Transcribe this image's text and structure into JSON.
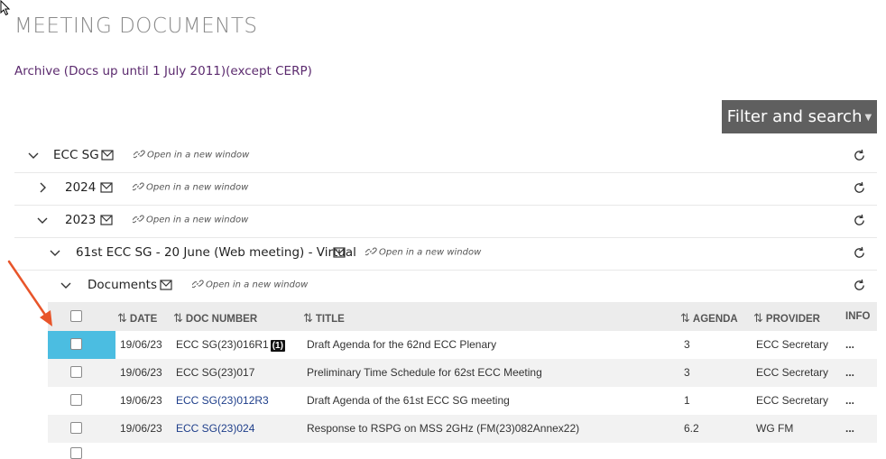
{
  "page": {
    "title": "MEETING DOCUMENTS",
    "archive_link": "Archive (Docs up until 1 July 2011)(except CERP)",
    "filter_button": "Filter and search"
  },
  "tree": {
    "open_new_window": "Open in a new window",
    "rows": [
      {
        "label": "ECC SG",
        "expanded": true
      },
      {
        "label": "2024",
        "expanded": false
      },
      {
        "label": "2023",
        "expanded": true
      },
      {
        "label": "61st ECC SG - 20 June (Web meeting) - Virtual",
        "expanded": true
      },
      {
        "label": "Documents",
        "expanded": true
      }
    ]
  },
  "table": {
    "headers": {
      "date": "DATE",
      "doc_number": "DOC NUMBER",
      "title": "TITLE",
      "agenda": "AGENDA",
      "provider": "PROVIDER",
      "info": "INFO"
    },
    "rows": [
      {
        "date": "19/06/23",
        "doc_number": "ECC SG(23)016R1",
        "badge": "(1)",
        "title": "Draft Agenda for the 62nd ECC Plenary",
        "agenda": "3",
        "provider": "ECC Secretary",
        "info": "...",
        "link": false
      },
      {
        "date": "19/06/23",
        "doc_number": "ECC SG(23)017",
        "badge": "",
        "title": "Preliminary Time Schedule for 62st ECC Meeting",
        "agenda": "3",
        "provider": "ECC Secretary",
        "info": "...",
        "link": false
      },
      {
        "date": "19/06/23",
        "doc_number": "ECC SG(23)012R3",
        "badge": "",
        "title": "Draft Agenda of the 61st ECC SG meeting",
        "agenda": "1",
        "provider": "ECC Secretary",
        "info": "...",
        "link": true
      },
      {
        "date": "19/06/23",
        "doc_number": "ECC SG(23)024",
        "badge": "",
        "title": "Response to RSPG on MSS 2GHz (FM(23)082Annex22)",
        "agenda": "6.2",
        "provider": "WG FM",
        "info": "...",
        "link": true
      }
    ]
  },
  "colors": {
    "highlight": "#4bbde1",
    "arrow": "#e8552a",
    "filter_bg": "#5f5f5f",
    "archive_link": "#5b2a6e",
    "doc_link": "#1e3e8a"
  }
}
